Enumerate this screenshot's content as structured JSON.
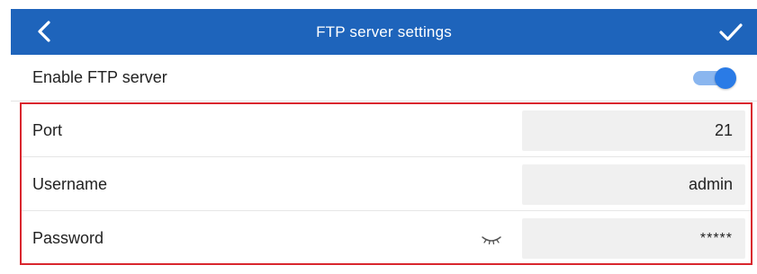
{
  "header": {
    "title": "FTP server settings",
    "back_icon": "chevron-left-icon",
    "confirm_icon": "check-icon",
    "background_color": "#1e64bb"
  },
  "enable": {
    "label": "Enable FTP server",
    "enabled": true,
    "accent_color": "#2a7be6"
  },
  "fields": {
    "port": {
      "label": "Port",
      "value": "21"
    },
    "username": {
      "label": "Username",
      "value": "admin"
    },
    "password": {
      "label": "Password",
      "value": "*****",
      "visibility_icon": "eye-closed-icon"
    }
  },
  "highlight_color": "#d9262e"
}
